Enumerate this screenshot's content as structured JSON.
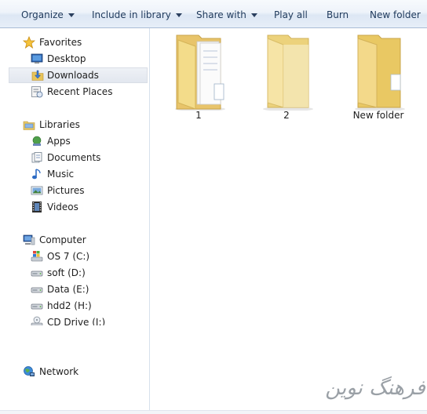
{
  "toolbar": {
    "organize": "Organize",
    "include_in_library": "Include in library",
    "share_with": "Share with",
    "play_all": "Play all",
    "burn": "Burn",
    "new_folder": "New folder"
  },
  "nav": {
    "favorites": "Favorites",
    "desktop": "Desktop",
    "downloads": "Downloads",
    "recent_places": "Recent Places",
    "libraries": "Libraries",
    "apps": "Apps",
    "documents": "Documents",
    "music": "Music",
    "pictures": "Pictures",
    "videos": "Videos",
    "computer": "Computer",
    "drives": [
      "OS 7 (C:)",
      "soft (D:)",
      "Data (E:)",
      "hdd2 (H:)",
      "CD Drive (I:)"
    ],
    "network": "Network",
    "selected": "Downloads"
  },
  "content": {
    "folders": [
      "1",
      "2",
      "New folder"
    ]
  },
  "watermark": "فرهنگ نوین",
  "colors": {
    "toolbar_text": "#1e395b",
    "folder_yellow": "#f3dc8a",
    "selected_bg": "#e6ebf2"
  }
}
